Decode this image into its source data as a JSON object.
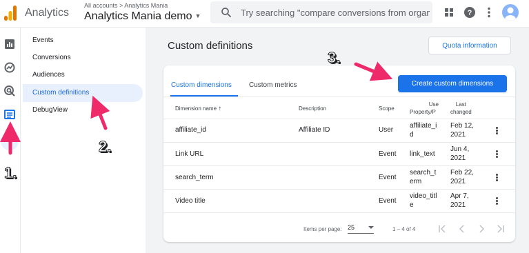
{
  "header": {
    "app_name": "Analytics",
    "breadcrumb": "All accounts > Analytics Mania",
    "property": "Analytics Mania demo",
    "search_placeholder": "Try searching \"compare conversions from organic...",
    "icons": [
      "apps-grid-icon",
      "help-icon",
      "more-vert-icon",
      "account-avatar"
    ]
  },
  "rail": {
    "icons": [
      "reports-icon",
      "explore-icon",
      "advertising-icon",
      "configure-icon"
    ]
  },
  "nav": {
    "items": [
      {
        "label": "Events",
        "active": false
      },
      {
        "label": "Conversions",
        "active": false
      },
      {
        "label": "Audiences",
        "active": false
      },
      {
        "label": "Custom definitions",
        "active": true
      },
      {
        "label": "DebugView",
        "active": false
      }
    ]
  },
  "page": {
    "title": "Custom definitions",
    "quota_button": "Quota information",
    "tabs": [
      {
        "label": "Custom dimensions",
        "active": true
      },
      {
        "label": "Custom metrics",
        "active": false
      }
    ],
    "create_button": "Create custom dimensions"
  },
  "table": {
    "headers": {
      "name": "Dimension name",
      "description": "Description",
      "scope": "Scope",
      "property_line1": "Use",
      "property_line2": "Property/P",
      "changed_line1": "Last",
      "changed_line2": "changed"
    },
    "rows": [
      {
        "name": "affiliate_id",
        "description": "Affiliate ID",
        "scope": "User",
        "prop1": "affiliate_i",
        "prop2": "d",
        "date1": "Feb 12,",
        "date2": "2021"
      },
      {
        "name": "Link URL",
        "description": "",
        "scope": "Event",
        "prop1": "link_text",
        "prop2": "",
        "date1": "Jun 4,",
        "date2": "2021"
      },
      {
        "name": "search_term",
        "description": "",
        "scope": "Event",
        "prop1": "search_t",
        "prop2": "erm",
        "date1": "Feb 22,",
        "date2": "2021"
      },
      {
        "name": "Video title",
        "description": "",
        "scope": "Event",
        "prop1": "video_titl",
        "prop2": "e",
        "date1": "Apr 7,",
        "date2": "2021"
      }
    ]
  },
  "pagination": {
    "items_per_page_label": "Items per page:",
    "items_per_page": "25",
    "range": "1 – 4 of 4"
  },
  "annotations": {
    "step1": "1.",
    "step2": "2.",
    "step3": "3.",
    "arrow_color": "#ee2a6b"
  },
  "colors": {
    "accent": "#1a73e8",
    "logo_orange": "#f9ab00",
    "logo_dark": "#e37400"
  }
}
